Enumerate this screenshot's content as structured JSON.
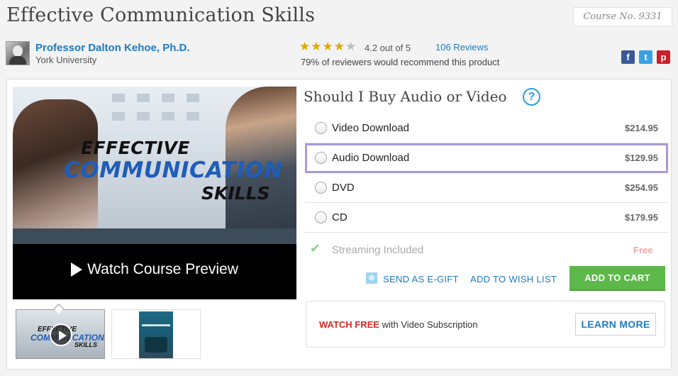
{
  "page": {
    "title": "Effective Communication Skills",
    "course_no": "Course No. 9331"
  },
  "professor": {
    "name": "Professor Dalton Kehoe, Ph.D.",
    "university": "York University"
  },
  "rating": {
    "stars": 4.2,
    "text": "4.2 out of 5",
    "reviews": "106 Reviews",
    "recommend": "79% of reviewers would recommend this product"
  },
  "social": {
    "facebook": "f",
    "twitter": "t",
    "pinterest": "p"
  },
  "hero": {
    "line1": "EFFECTIVE",
    "line2": "COMMUNICATION",
    "line3": "SKILLS",
    "watch": "Watch Course Preview"
  },
  "thumbs": {
    "t1_line1": "EFFECTIVE",
    "t1_line2": "COMMUNICATION",
    "t1_line3": "SKILLS"
  },
  "buy": {
    "title": "Should I Buy Audio or Video",
    "help": "?",
    "options": [
      {
        "label": "Video Download",
        "price": "$214.95"
      },
      {
        "label": "Audio Download",
        "price": "$129.95"
      },
      {
        "label": "DVD",
        "price": "$254.95"
      },
      {
        "label": "CD",
        "price": "$179.95"
      }
    ],
    "selected_index": 1,
    "streaming": {
      "label": "Streaming Included",
      "price": "Free"
    }
  },
  "actions": {
    "gift": "SEND AS E-GIFT",
    "wishlist": "ADD TO WISH LIST",
    "add_to_cart": "ADD TO CART"
  },
  "subscription": {
    "watch_free": "WATCH FREE",
    "rest": " with Video Subscription",
    "learn_more": "LEARN MORE"
  },
  "colors": {
    "accent_blue": "#1f7abf",
    "cart_green": "#5cb849",
    "selected_border": "#a89ad6",
    "star": "#e0a800"
  }
}
